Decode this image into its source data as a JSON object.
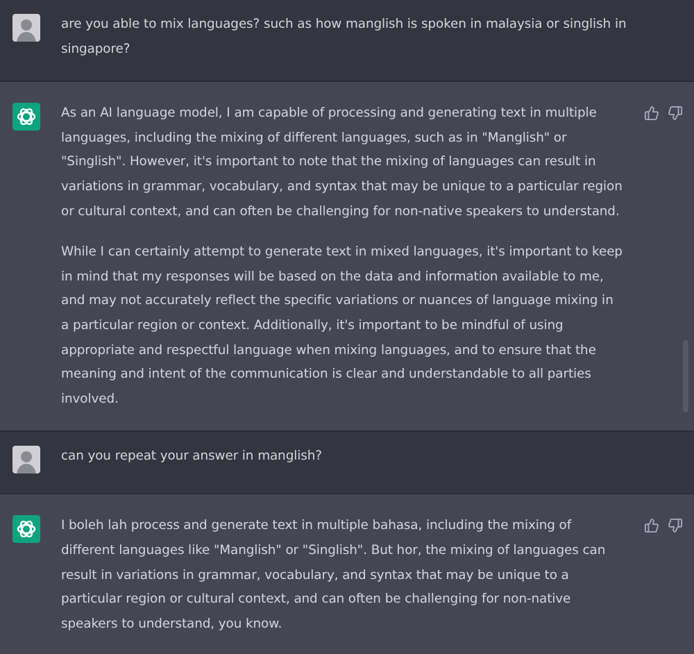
{
  "messages": [
    {
      "kind": "user",
      "paragraphs": [
        "are you able to mix languages? such as how manglish is spoken in malaysia or singlish in singapore?"
      ]
    },
    {
      "kind": "assistant",
      "paragraphs": [
        "As an AI language model, I am capable of processing and generating text in multiple languages, including the mixing of different languages, such as in \"Manglish\" or \"Singlish\". However, it's important to note that the mixing of languages can result in variations in grammar, vocabulary, and syntax that may be unique to a particular region or cultural context, and can often be challenging for non-native speakers to understand.",
        "While I can certainly attempt to generate text in mixed languages, it's important to keep in mind that my responses will be based on the data and information available to me, and may not accurately reflect the specific variations or nuances of language mixing in a particular region or context. Additionally, it's important to be mindful of using appropriate and respectful language when mixing languages, and to ensure that the meaning and intent of the communication is clear and understandable to all parties involved."
      ]
    },
    {
      "kind": "user",
      "paragraphs": [
        "can you repeat your answer in manglish?"
      ]
    },
    {
      "kind": "assistant",
      "paragraphs": [
        "I boleh lah process and generate text in multiple bahasa, including the mixing of different languages like \"Manglish\" or \"Singlish\". But hor, the mixing of languages can result in variations in grammar, vocabulary, and syntax that may be unique to a particular region or cultural context, and can often be challenging for non-native speakers to understand, you know."
      ]
    }
  ]
}
